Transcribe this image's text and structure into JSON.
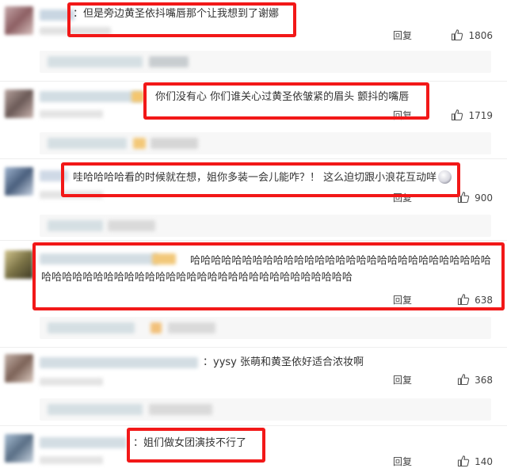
{
  "reply_label": "回复",
  "comments": [
    {
      "text": "：但是旁边黄圣依抖嘴唇那个让我想到了谢娜",
      "likes": "1806"
    },
    {
      "text": "你们没有心 你们谁关心过黄圣依皱紧的眉头 颤抖的嘴唇",
      "likes": "1719"
    },
    {
      "text": "哇哈哈哈哈看的时候就在想，姐你多装一会儿能咋？！ 这么迫切跟小浪花互动咩",
      "likes": "900"
    },
    {
      "text": "哈哈哈哈哈哈哈哈哈哈哈哈哈哈哈哈哈哈哈哈哈哈哈哈哈哈哈哈哈哈哈哈哈哈哈哈哈哈哈哈哈哈哈哈哈哈哈哈哈哈哈哈哈哈哈哈哈哈哈",
      "likes": "638"
    },
    {
      "text": "：yysy 张萌和黄圣依好适合浓妆啊",
      "likes": "368"
    },
    {
      "text": "：姐们做女团演技不行了",
      "likes": "140"
    }
  ],
  "icons": {
    "like": "thumbs-up-icon",
    "emoji": "emoji-face-icon"
  },
  "colors": {
    "highlight": "#f21818",
    "text": "#333333",
    "sub_bg": "#f7f7f7"
  }
}
